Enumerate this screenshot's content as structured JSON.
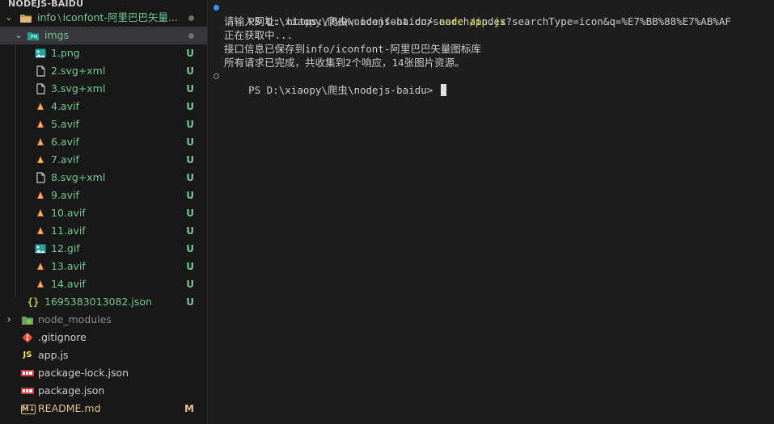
{
  "explorer": {
    "section_title": "NODEJS-BAIDU",
    "folder_info": {
      "name": "info",
      "sep": "\\",
      "child": "iconfont-阿里巴巴矢量..."
    },
    "folder_imgs": {
      "name": "imgs"
    },
    "imgs_files": [
      {
        "name": "1.png",
        "type": "image",
        "status": "U"
      },
      {
        "name": "2.svg+xml",
        "type": "file",
        "status": "U"
      },
      {
        "name": "3.svg+xml",
        "type": "file",
        "status": "U"
      },
      {
        "name": "4.avif",
        "type": "avif",
        "status": "U"
      },
      {
        "name": "5.avif",
        "type": "avif",
        "status": "U"
      },
      {
        "name": "6.avif",
        "type": "avif",
        "status": "U"
      },
      {
        "name": "7.avif",
        "type": "avif",
        "status": "U"
      },
      {
        "name": "8.svg+xml",
        "type": "file",
        "status": "U"
      },
      {
        "name": "9.avif",
        "type": "avif",
        "status": "U"
      },
      {
        "name": "10.avif",
        "type": "avif",
        "status": "U"
      },
      {
        "name": "11.avif",
        "type": "avif",
        "status": "U"
      },
      {
        "name": "12.gif",
        "type": "image",
        "status": "U"
      },
      {
        "name": "13.avif",
        "type": "avif",
        "status": "U"
      },
      {
        "name": "14.avif",
        "type": "avif",
        "status": "U"
      }
    ],
    "json_file": {
      "icon_text": "{}",
      "name": "1695383013082.json",
      "status": "U"
    },
    "root_items": [
      {
        "name": "node_modules",
        "type": "node",
        "status": ""
      },
      {
        "name": ".gitignore",
        "type": "git",
        "status": ""
      },
      {
        "name": "app.js",
        "type": "js",
        "icon_text": "JS",
        "status": ""
      },
      {
        "name": "package-lock.json",
        "type": "npm",
        "status": ""
      },
      {
        "name": "package.json",
        "type": "npm",
        "status": ""
      },
      {
        "name": "README.md",
        "type": "md",
        "icon_text": "M↓",
        "status": "M"
      }
    ]
  },
  "terminal": {
    "prompt": "PS D:\\xiaopy\\爬虫\\nodejs-baidu>",
    "command": "node app.js",
    "output": [
      "请输入网址: https://www.iconfont.cn/search/index?searchType=icon&q=%E7%BB%88%E7%AB%AF",
      "正在获取中...",
      "接口信息已保存到info/iconfont-阿里巴巴矢量图标库",
      "所有请求已完成，共收集到2个响应，14张图片资源。"
    ],
    "prompt2": "PS D:\\xiaopy\\爬虫\\nodejs-baidu>"
  },
  "colors": {
    "untracked": "#73c991",
    "modified": "#e2c08d",
    "muted": "#8c8c8c",
    "dot": "#6e6e6e",
    "terminal_dot": "#3794ff",
    "command": "#e5e510"
  },
  "icons": {
    "folder_open": "folder-open-icon",
    "image": "image-file-icon",
    "file": "file-icon",
    "avif": "avif-file-icon",
    "json": "json-braces-icon",
    "node": "node-modules-folder-icon",
    "git": "git-icon",
    "js": "js-file-icon",
    "npm": "npm-icon",
    "md": "markdown-icon"
  }
}
